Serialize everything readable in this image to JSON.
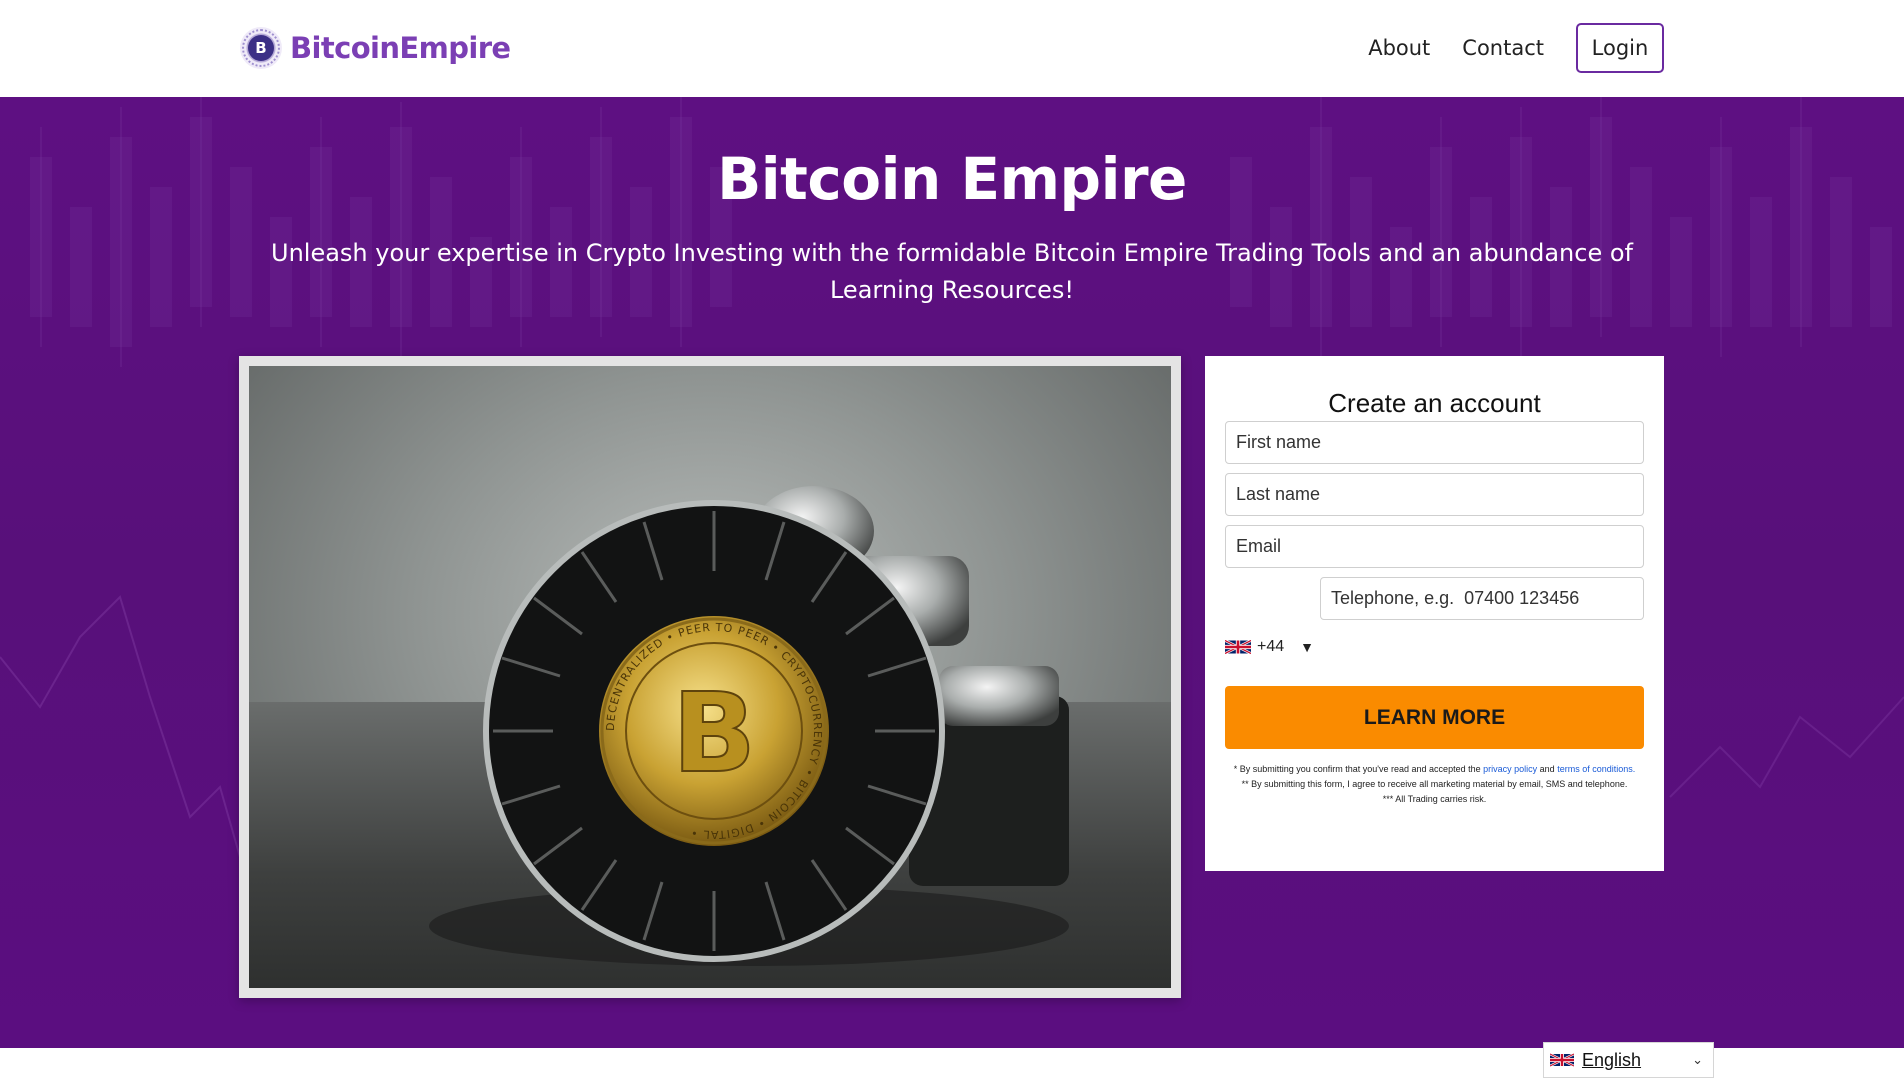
{
  "header": {
    "logo_letter": "B",
    "logo_text": "BitcoinEmpire",
    "nav": [
      {
        "label": "About"
      },
      {
        "label": "Contact"
      }
    ],
    "login_label": "Login"
  },
  "hero": {
    "title": "Bitcoin Empire",
    "subtitle": "Unleash your expertise in Crypto Investing with the formidable Bitcoin Empire Trading Tools and an abundance of Learning Resources!"
  },
  "image": {
    "coin_letter": "B",
    "coin_ring_text": "DECENTRALIZED • PEER TO PEER • CRYPTOCURRENCY • BITCOIN • DIGITAL •"
  },
  "form": {
    "title": "Create an account",
    "first_name_placeholder": "First name",
    "last_name_placeholder": "Last name",
    "email_placeholder": "Email",
    "phone_prefix": "+44",
    "phone_placeholder": "Telephone, e.g.  07400 123456",
    "submit_label": "LEARN MORE",
    "disclaimer": {
      "line1_pre": "* By submitting you confirm that you've read and accepted the",
      "privacy_link": "privacy policy",
      "and": "and",
      "terms_link": "terms of conditions.",
      "line2": "** By submitting this form, I agree to receive all marketing material by email, SMS and telephone.",
      "line3": "*** All Trading carries risk."
    }
  },
  "language": {
    "label": "English"
  },
  "colors": {
    "brand_purple": "#7b3fb4",
    "hero_bg": "#5e1082",
    "cta_orange": "#fa8b00",
    "link_blue": "#1a5bd7"
  }
}
